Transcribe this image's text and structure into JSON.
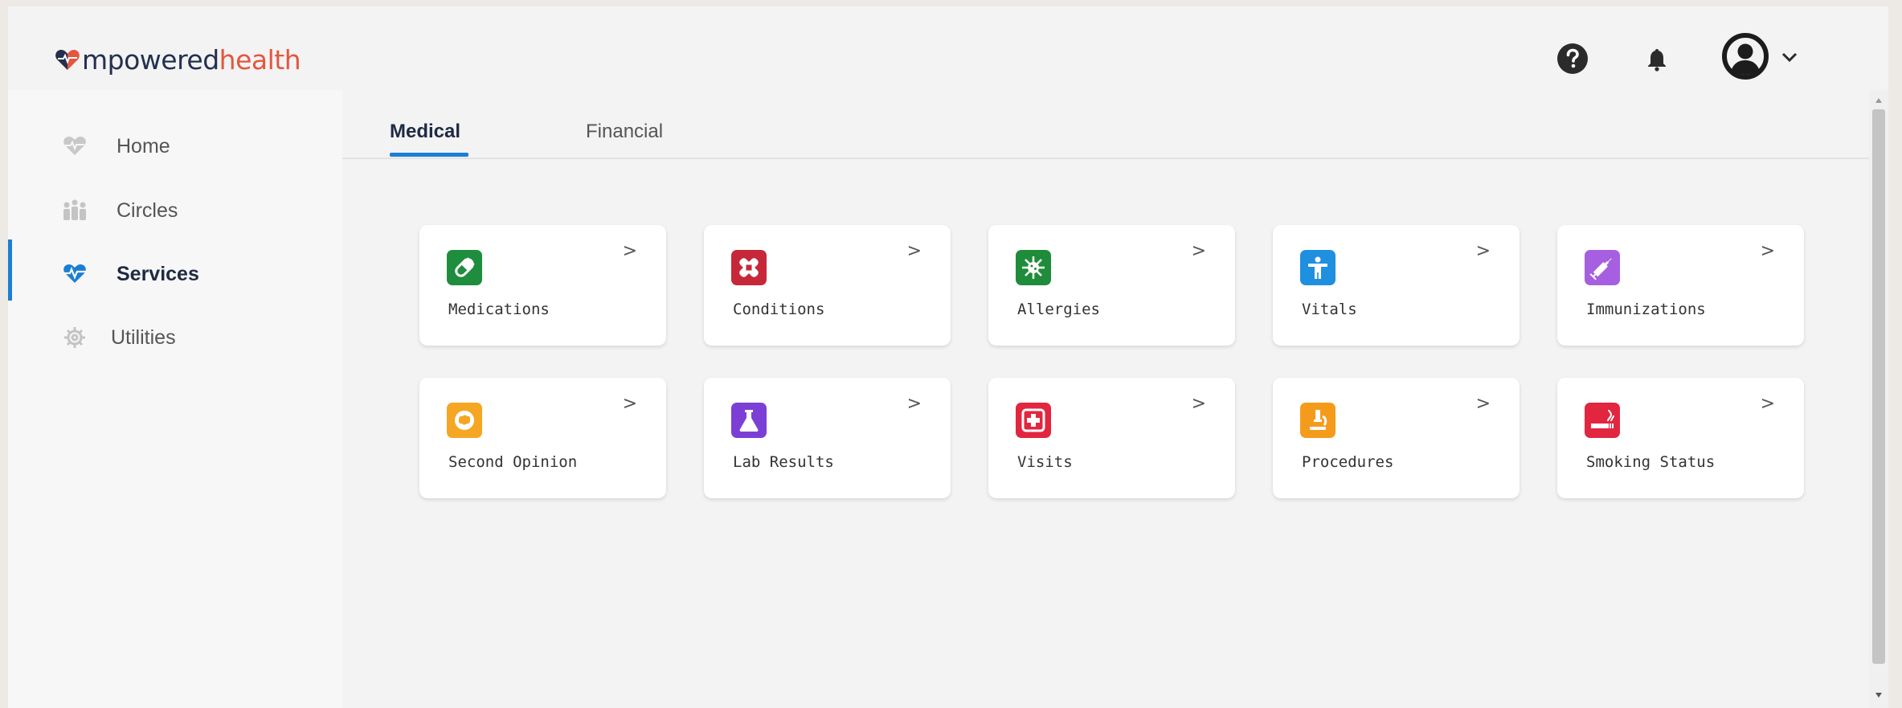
{
  "brand": {
    "logo_part1": "mpowered",
    "logo_part2": "health"
  },
  "header": {
    "icons": [
      "help-icon",
      "bell-icon",
      "user-icon",
      "chevron-down-icon"
    ]
  },
  "sidebar": {
    "items": [
      {
        "label": "Home",
        "icon": "heart-icon",
        "active": false
      },
      {
        "label": "Circles",
        "icon": "people-icon",
        "active": false
      },
      {
        "label": "Services",
        "icon": "heartbeat-icon",
        "active": true
      },
      {
        "label": "Utilities",
        "icon": "gear-icon",
        "active": false
      }
    ]
  },
  "tabs": [
    {
      "label": "Medical",
      "active": true
    },
    {
      "label": "Financial",
      "active": false
    }
  ],
  "cards": [
    {
      "label": "Medications",
      "icon": "pill-icon",
      "color": "#1e8e3e",
      "arrow": ">"
    },
    {
      "label": "Conditions",
      "icon": "bandage-icon",
      "color": "#c62839",
      "arrow": ">"
    },
    {
      "label": "Allergies",
      "icon": "virus-icon",
      "color": "#1f8c3b",
      "arrow": ">"
    },
    {
      "label": "Vitals",
      "icon": "person-icon",
      "color": "#1f8fe0",
      "arrow": ">"
    },
    {
      "label": "Immunizations",
      "icon": "syringe-icon",
      "color": "#a65fe0",
      "arrow": ">"
    },
    {
      "label": "Second Opinion",
      "icon": "brain-icon",
      "color": "#f5a623",
      "arrow": ">"
    },
    {
      "label": "Lab Results",
      "icon": "flask-icon",
      "color": "#7c3fd6",
      "arrow": ">"
    },
    {
      "label": "Visits",
      "icon": "medical-cross-icon",
      "color": "#e2263f",
      "arrow": ">"
    },
    {
      "label": "Procedures",
      "icon": "microscope-icon",
      "color": "#f59b1b",
      "arrow": ">"
    },
    {
      "label": "Smoking Status",
      "icon": "smoking-icon",
      "color": "#e2263f",
      "arrow": ">"
    }
  ]
}
